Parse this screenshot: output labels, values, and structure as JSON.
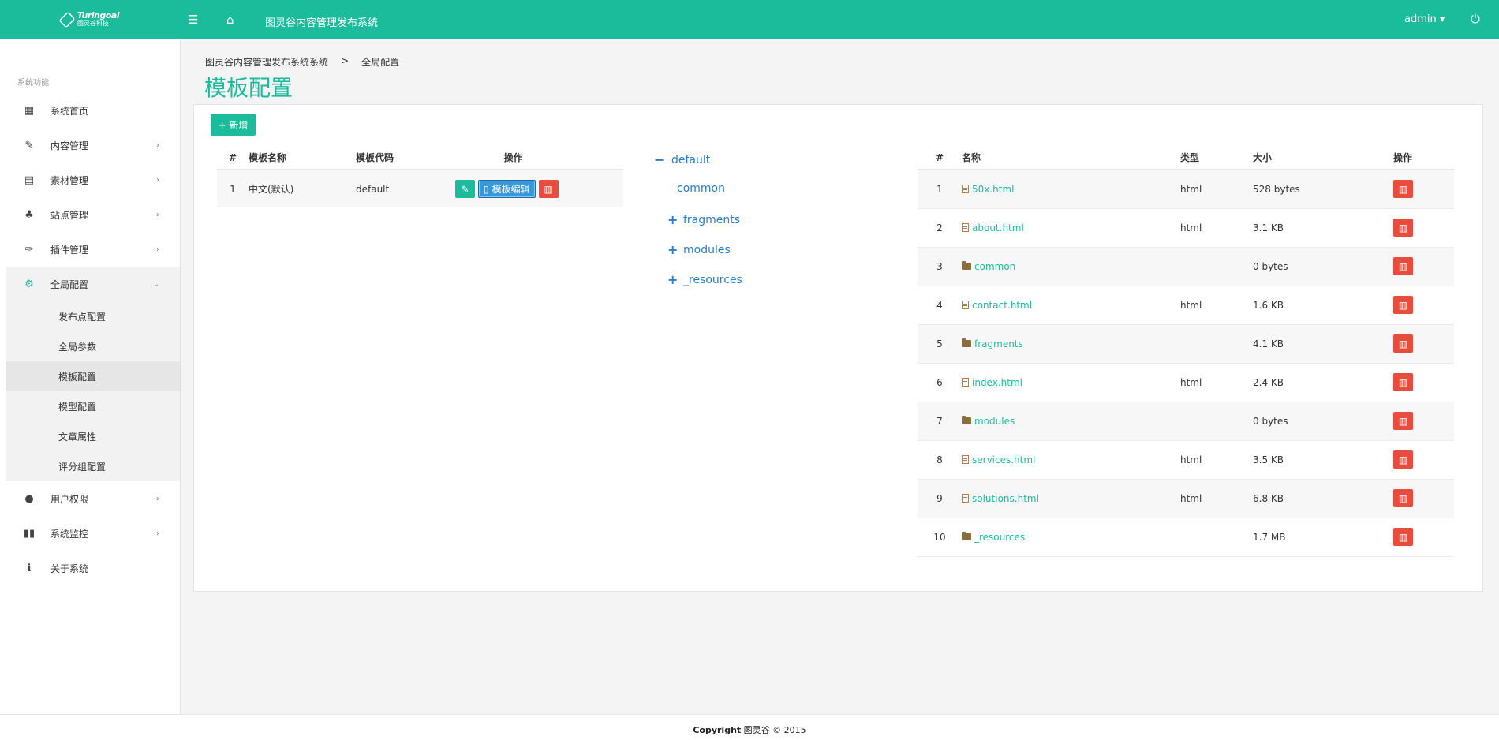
{
  "header": {
    "logo_en": "Turingoal",
    "logo_cn": "图灵谷科技",
    "title": "图灵谷内容管理发布系统",
    "user": "admin ▾",
    "icons": {
      "menu": "menu-icon",
      "home": "home-icon",
      "power": "power-icon"
    }
  },
  "sidebar": {
    "section": "系统功能",
    "items": [
      {
        "label": "系统首页",
        "icon": "dashboard-icon",
        "glyph": "▦"
      },
      {
        "label": "内容管理",
        "icon": "edit-icon",
        "glyph": "✎",
        "chevron": "›"
      },
      {
        "label": "素材管理",
        "icon": "film-icon",
        "glyph": "▤",
        "chevron": "›"
      },
      {
        "label": "站点管理",
        "icon": "sitemap-icon",
        "glyph": "♣",
        "chevron": "›"
      },
      {
        "label": "插件管理",
        "icon": "plug-icon",
        "glyph": "✑",
        "chevron": "›"
      },
      {
        "label": "全局配置",
        "icon": "gears-icon",
        "glyph": "⚙",
        "chevron": "⌄"
      },
      {
        "label": "用户权限",
        "icon": "user-icon",
        "glyph": "●",
        "chevron": "›"
      },
      {
        "label": "系统监控",
        "icon": "binoculars-icon",
        "glyph": "▮▮",
        "chevron": "›"
      },
      {
        "label": "关于系统",
        "icon": "info-icon",
        "glyph": "ℹ"
      }
    ],
    "subitems": [
      "发布点配置",
      "全局参数",
      "模板配置",
      "模型配置",
      "文章属性",
      "评分组配置"
    ]
  },
  "breadcrumb": {
    "root": "图灵谷内容管理发布系统系统",
    "sep": ">",
    "current": "全局配置"
  },
  "page": {
    "title": "模板配置",
    "add_button": "+ 新增"
  },
  "template_table": {
    "headers": [
      "#",
      "模板名称",
      "模板代码",
      "操作"
    ],
    "rows": [
      {
        "no": "1",
        "name": "中文(默认)",
        "code": "default",
        "edit_label": "模板编辑"
      }
    ]
  },
  "tree": {
    "root": "default",
    "root_sign": "−",
    "children": [
      {
        "label": "common",
        "sign": ""
      },
      {
        "label": "fragments",
        "sign": "+"
      },
      {
        "label": "modules",
        "sign": "+"
      },
      {
        "label": "_resources",
        "sign": "+"
      }
    ]
  },
  "file_table": {
    "headers": [
      "#",
      "名称",
      "类型",
      "大小",
      "操作"
    ],
    "rows": [
      {
        "no": "1",
        "name": "50x.html",
        "kind": "file",
        "type": "html",
        "size": "528 bytes"
      },
      {
        "no": "2",
        "name": "about.html",
        "kind": "file",
        "type": "html",
        "size": "3.1 KB"
      },
      {
        "no": "3",
        "name": "common",
        "kind": "folder",
        "type": "",
        "size": "0 bytes"
      },
      {
        "no": "4",
        "name": "contact.html",
        "kind": "file",
        "type": "html",
        "size": "1.6 KB"
      },
      {
        "no": "5",
        "name": "fragments",
        "kind": "folder",
        "type": "",
        "size": "4.1 KB"
      },
      {
        "no": "6",
        "name": "index.html",
        "kind": "file",
        "type": "html",
        "size": "2.4 KB"
      },
      {
        "no": "7",
        "name": "modules",
        "kind": "folder",
        "type": "",
        "size": "0 bytes"
      },
      {
        "no": "8",
        "name": "services.html",
        "kind": "file",
        "type": "html",
        "size": "3.5 KB"
      },
      {
        "no": "9",
        "name": "solutions.html",
        "kind": "file",
        "type": "html",
        "size": "6.8 KB"
      },
      {
        "no": "10",
        "name": "_resources",
        "kind": "folder",
        "type": "",
        "size": "1.7 MB"
      }
    ]
  },
  "footer": {
    "brand": "Copyright",
    "text": "图灵谷 © 2015"
  },
  "colors": {
    "accent": "#1abc9c",
    "danger": "#e74c3c",
    "info": "#3498db",
    "link": "#2a7ec9"
  }
}
